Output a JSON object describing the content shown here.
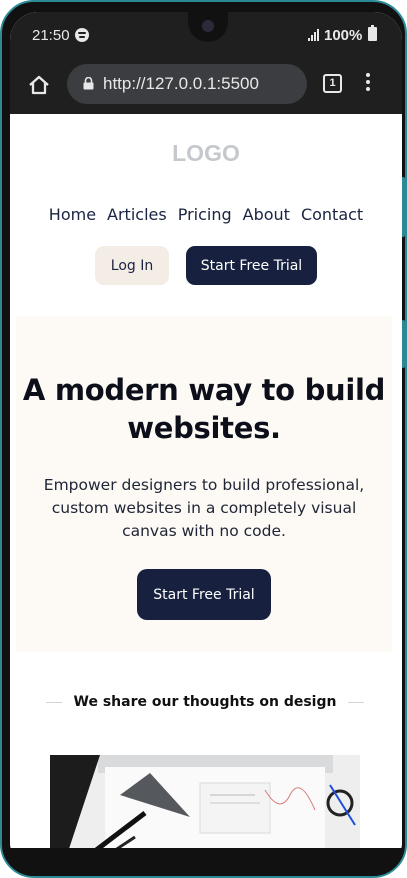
{
  "statusbar": {
    "time": "21:50",
    "battery": "100%"
  },
  "browser": {
    "url": "http://127.0.0.1:5500",
    "tab_count": "1"
  },
  "site": {
    "logo": "LOGO",
    "nav": [
      "Home",
      "Articles",
      "Pricing",
      "About",
      "Contact"
    ],
    "login_label": "Log In",
    "trial_label": "Start Free Trial"
  },
  "hero": {
    "title": "A modern way to build websites.",
    "subtitle": "Empower designers to build professional, custom websites in a completely visual canvas with no code.",
    "cta_label": "Start Free Trial"
  },
  "section": {
    "heading": "We share our thoughts on design"
  },
  "colors": {
    "frame_accent": "#2b8a95",
    "navy": "#17213f",
    "hero_bg": "#fdfaf5",
    "login_bg": "#f4ede6"
  }
}
